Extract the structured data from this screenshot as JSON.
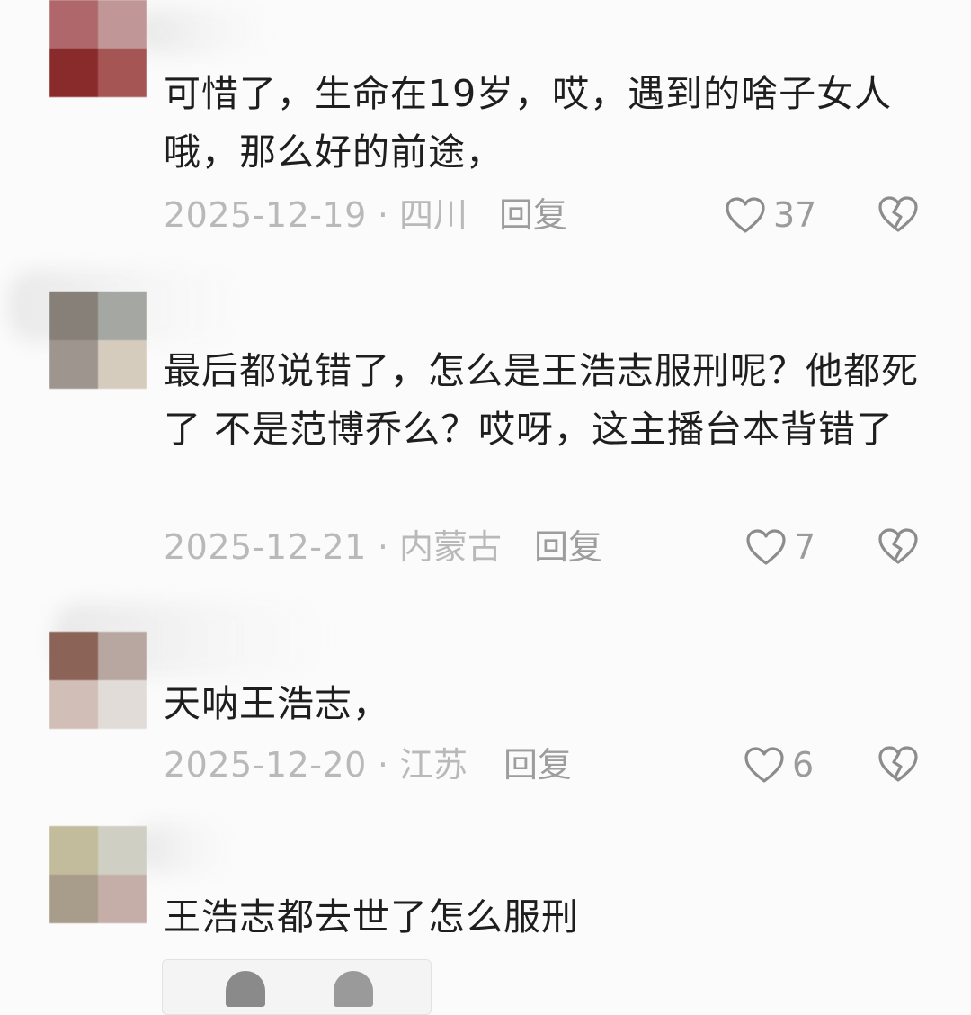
{
  "comments": [
    {
      "text": "可惜了，生命在19岁，哎，遇到的啥子女人哦，那么好的前途，",
      "date": "2025-12-19",
      "region": "四川",
      "reply_label": "回复",
      "likes": "37",
      "avatar_colors": [
        "#b0676b",
        "#c09796",
        "#8a2b2b",
        "#a65555"
      ]
    },
    {
      "text": "最后都说错了，怎么是王浩志服刑呢？他都死了 不是范博乔么？哎呀，这主播台本背错了",
      "date": "2025-12-21",
      "region": "内蒙古",
      "reply_label": "回复",
      "likes": "7",
      "avatar_colors": [
        "#878079",
        "#a5a7a3",
        "#9e958f",
        "#d6ccbe"
      ]
    },
    {
      "text": "天呐王浩志，",
      "date": "2025-12-20",
      "region": "江苏",
      "reply_label": "回复",
      "likes": "6",
      "avatar_colors": [
        "#8b6457",
        "#b8a7a1",
        "#d1beb7",
        "#e2dcd9"
      ]
    },
    {
      "text": "王浩志都去世了怎么服刑",
      "avatar_colors": [
        "#c2bb9c",
        "#cfcfc3",
        "#a89c8b",
        "#c6aea8"
      ]
    }
  ],
  "icons": {
    "like": "heart-outline-icon",
    "dislike": "broken-heart-icon"
  },
  "colors": {
    "background": "#fbfbfb",
    "text": "#1e1e1e",
    "meta": "#b9b9b9",
    "reply": "#9d9d9d"
  }
}
